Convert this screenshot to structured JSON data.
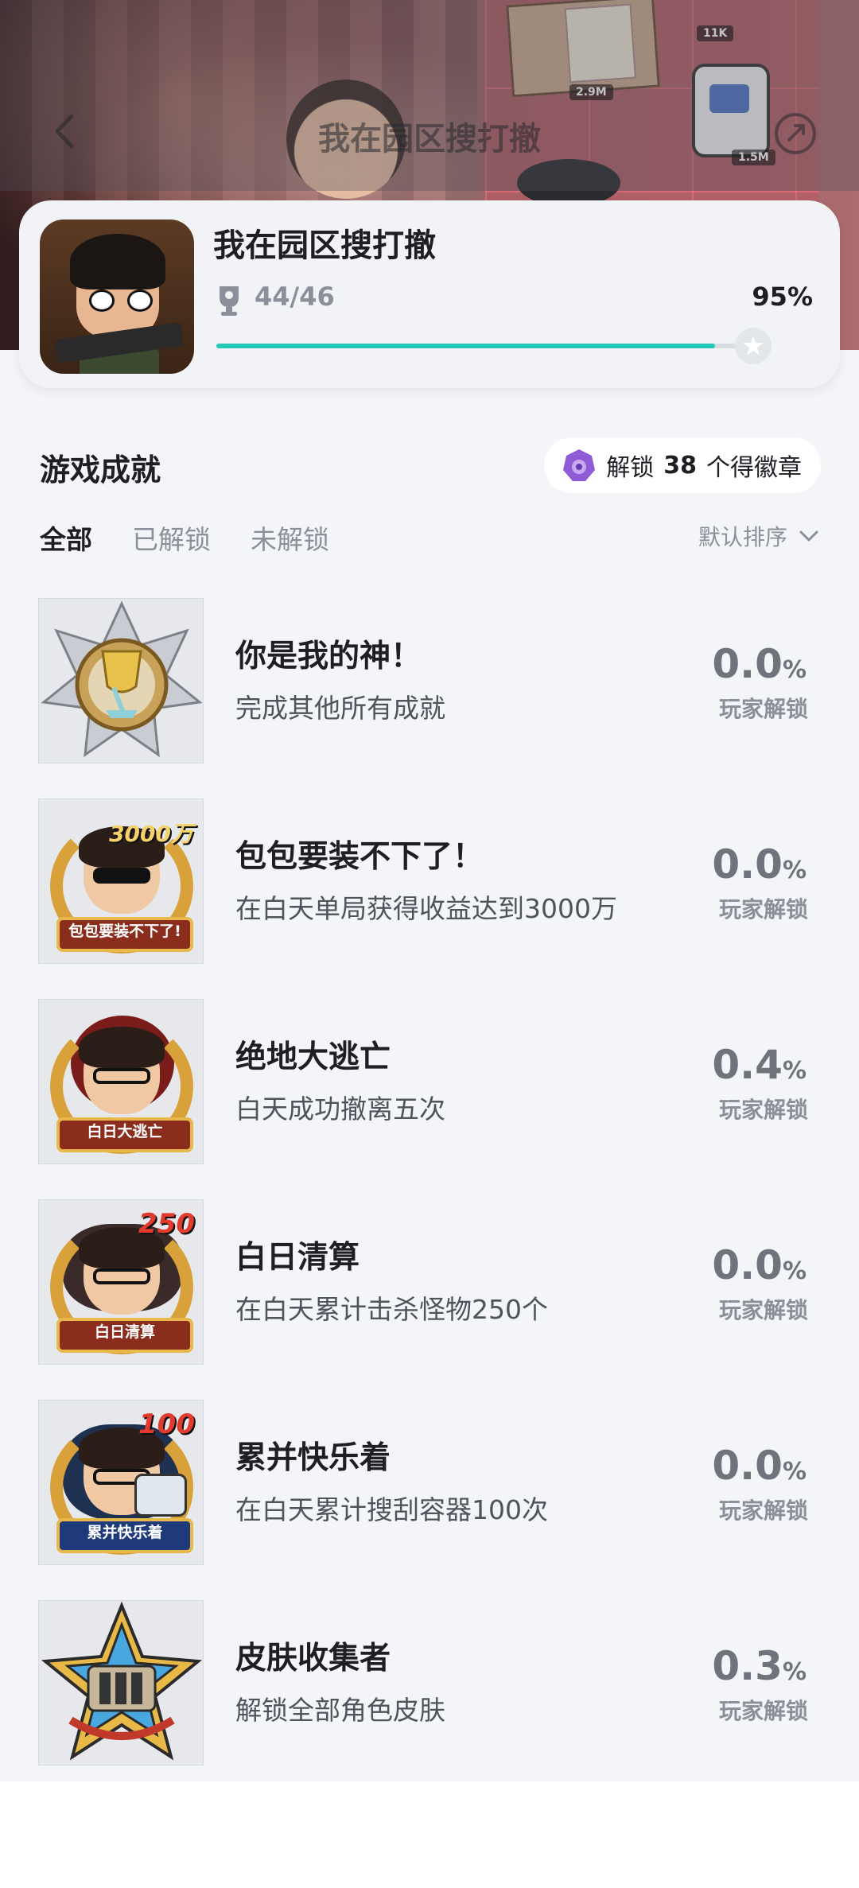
{
  "header": {
    "title": "我在园区搜打撤"
  },
  "hero_tags": [
    "2.9M",
    "11K",
    "1.5M"
  ],
  "game": {
    "name": "我在园区搜打撤",
    "achievement_count": "44/46",
    "percent": "95%",
    "progress": 0.95
  },
  "section": {
    "title": "游戏成就",
    "badge_pill": {
      "prefix": "解锁",
      "number": "38",
      "suffix": "个得徽章"
    }
  },
  "tabs": [
    {
      "label": "全部",
      "active": true
    },
    {
      "label": "已解锁",
      "active": false
    },
    {
      "label": "未解锁",
      "active": false
    }
  ],
  "sort": {
    "label": "默认排序"
  },
  "achievements": [
    {
      "name": "你是我的神！",
      "desc": "完成其他所有成就",
      "rate": "0.0",
      "pct": "%",
      "rate_label": "玩家解锁",
      "icon": "trophy-star-badge-icon",
      "ribbon": ""
    },
    {
      "name": "包包要装不下了！",
      "desc": "在白天单局获得收益达到3000万",
      "rate": "0.0",
      "pct": "%",
      "rate_label": "玩家解锁",
      "icon": "money-bag-badge-icon",
      "ribbon": "包包要装不下了!",
      "big": "3000万"
    },
    {
      "name": "绝地大逃亡",
      "desc": "白天成功撤离五次",
      "rate": "0.4",
      "pct": "%",
      "rate_label": "玩家解锁",
      "icon": "escape-badge-icon",
      "ribbon": "白日大逃亡"
    },
    {
      "name": "白日清算",
      "desc": "在白天累计击杀怪物250个",
      "rate": "0.0",
      "pct": "%",
      "rate_label": "玩家解锁",
      "icon": "kill-count-badge-icon",
      "ribbon": "白日清算",
      "big": "250"
    },
    {
      "name": "累并快乐着",
      "desc": "在白天累计搜刮容器100次",
      "rate": "0.0",
      "pct": "%",
      "rate_label": "玩家解锁",
      "icon": "loot-badge-icon",
      "ribbon": "累并快乐着",
      "big": "100"
    },
    {
      "name": "皮肤收集者",
      "desc": "解锁全部角色皮肤",
      "rate": "0.3",
      "pct": "%",
      "rate_label": "玩家解锁",
      "icon": "skin-collector-badge-icon",
      "ribbon": ""
    }
  ],
  "colors": {
    "accent": "#25c7b6",
    "badge_gem": "#8f5bd6",
    "ribbon": "#8b2d1c",
    "gold": "#d9a13a"
  }
}
